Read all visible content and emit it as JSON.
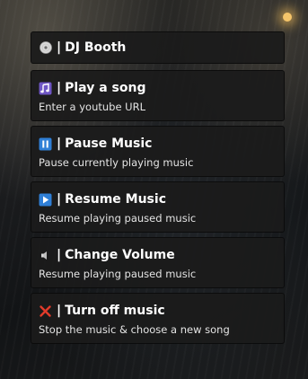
{
  "menu": {
    "header": {
      "icon": "disc-icon",
      "separator": "|",
      "title": "DJ Booth"
    },
    "items": [
      {
        "icon": "music-notes-icon",
        "separator": "|",
        "title": "Play a song",
        "description": "Enter a youtube URL"
      },
      {
        "icon": "pause-icon",
        "separator": "|",
        "title": "Pause Music",
        "description": "Pause currently playing music"
      },
      {
        "icon": "play-icon",
        "separator": "|",
        "title": "Resume Music",
        "description": "Resume playing paused music"
      },
      {
        "icon": "speaker-icon",
        "separator": "|",
        "title": "Change Volume",
        "description": "Resume playing paused music"
      },
      {
        "icon": "red-x-icon",
        "separator": "|",
        "title": "Turn off music",
        "description": "Stop the music & choose a new song"
      }
    ]
  },
  "colors": {
    "item_background": "#1b1b1b",
    "title_text": "#ffffff",
    "description_text": "#e4e4e4",
    "pause_icon_blue": "#2f7fd6",
    "play_icon_blue": "#2f7fd6",
    "close_icon_red": "#e23b2b",
    "music_icon_purple": "#8a6fd1"
  }
}
